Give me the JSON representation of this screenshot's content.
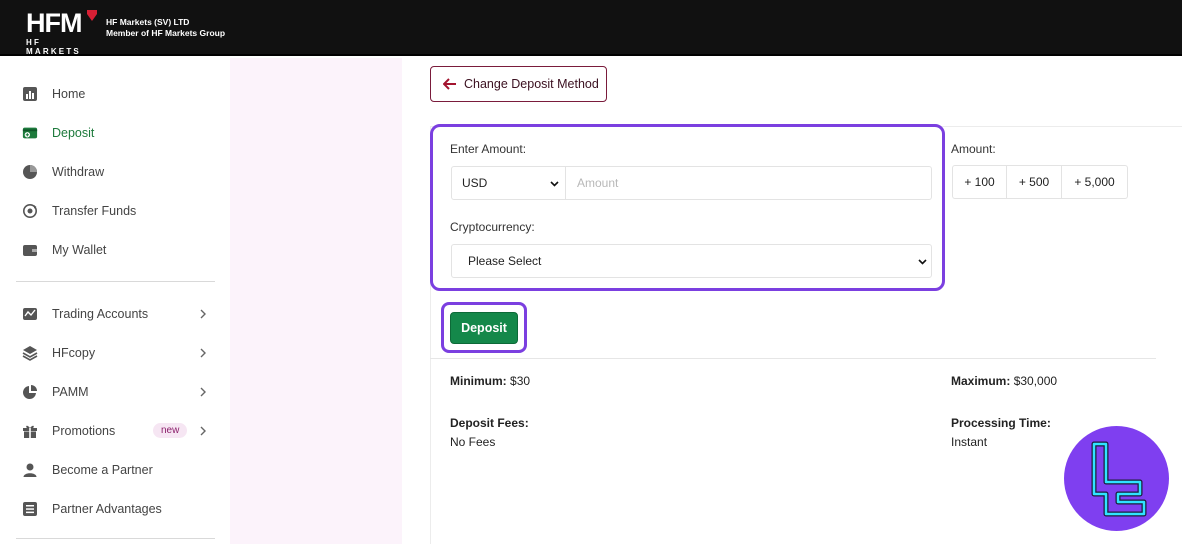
{
  "header": {
    "logo_text": "HFM",
    "logo_sub": "HF MARKETS",
    "company_line1": "HF Markets (SV) LTD",
    "company_line2": "Member of HF Markets Group"
  },
  "sidebar": {
    "items": [
      {
        "label": "Home",
        "icon": "bar-chart-icon"
      },
      {
        "label": "Deposit",
        "icon": "deposit-wallet-icon",
        "active": true
      },
      {
        "label": "Withdraw",
        "icon": "pie-chart-icon"
      },
      {
        "label": "Transfer Funds",
        "icon": "transfer-icon"
      },
      {
        "label": "My Wallet",
        "icon": "wallet-icon"
      },
      {
        "label": "Trading Accounts",
        "icon": "chart-line-icon",
        "has_chevron": true
      },
      {
        "label": "HFcopy",
        "icon": "layers-icon",
        "has_chevron": true
      },
      {
        "label": "PAMM",
        "icon": "pie-icon",
        "has_chevron": true
      },
      {
        "label": "Promotions",
        "icon": "gift-icon",
        "has_chevron": true,
        "badge": "new"
      },
      {
        "label": "Become a Partner",
        "icon": "person-icon"
      },
      {
        "label": "Partner Advantages",
        "icon": "list-icon"
      }
    ]
  },
  "main": {
    "change_method_label": "Change Deposit Method",
    "enter_amount_label": "Enter Amount:",
    "currency_value": "USD",
    "amount_placeholder": "Amount",
    "crypto_label": "Cryptocurrency:",
    "crypto_value": "Please Select",
    "quick_amount_label": "Amount:",
    "quick_amounts": [
      "+ 100",
      "+ 500",
      "+ 5,000"
    ],
    "deposit_button": "Deposit",
    "minimum_label": "Minimum:",
    "minimum_value": "$30",
    "maximum_label": "Maximum:",
    "maximum_value": "$30,000",
    "fees_label": "Deposit Fees:",
    "fees_value": "No Fees",
    "processing_label": "Processing Time:",
    "processing_value": "Instant"
  },
  "colors": {
    "accent_highlight": "#7b3fe0",
    "deposit_green": "#14884a",
    "active_nav": "#1d7a3c",
    "brand_maroon": "#7a1b3b"
  }
}
